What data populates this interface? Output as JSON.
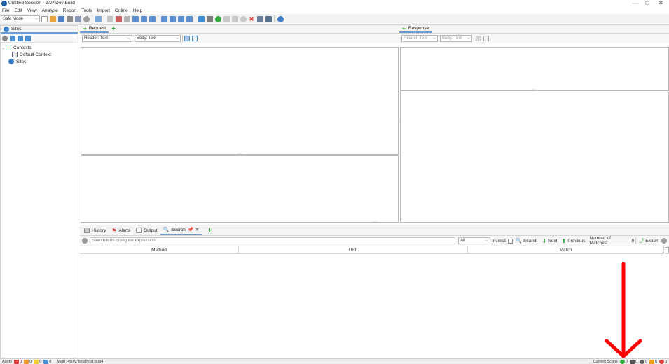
{
  "window": {
    "title": "Untitled Session - ZAP Dev Build",
    "minimize": "—",
    "maximize": "❐",
    "close": "✕"
  },
  "menu": [
    "File",
    "Edit",
    "View",
    "Analyse",
    "Report",
    "Tools",
    "Import",
    "Online",
    "Help"
  ],
  "toolbar": {
    "mode": "Safe Mode"
  },
  "sites_panel": {
    "tab_label": "Sites",
    "tree": {
      "contexts": "Contexts",
      "default_context": "Default Context",
      "sites": "Sites"
    }
  },
  "request_panel": {
    "tab_label": "Request",
    "header_combo": "Header: Text",
    "body_combo": "Body: Text"
  },
  "response_panel": {
    "tab_label": "Response",
    "header_combo": "Header: Text",
    "body_combo": "Body: Text"
  },
  "bottom_tabs": {
    "history": "History",
    "alerts": "Alerts",
    "output": "Output",
    "search": "Search"
  },
  "search_bar": {
    "placeholder": "Search term or regular expression",
    "scope": "All",
    "inverse": "Inverse",
    "search_btn": "Search",
    "next_btn": "Next",
    "previous_btn": "Previous",
    "matches_label": "Number of Matches:",
    "matches_value": "0",
    "export_btn": "Export"
  },
  "results_table": {
    "columns": [
      "Method",
      "URL",
      "Match"
    ]
  },
  "status_bar": {
    "alerts_label": "Alerts",
    "alert_counts": [
      "0",
      "0",
      "0",
      "0"
    ],
    "proxy": "Main Proxy: localhost:8094",
    "current_scans_label": "Current Scans",
    "scan_counts": [
      "0",
      "0",
      "0",
      "0",
      "0"
    ]
  },
  "colors": {
    "arrow": "#ff0000",
    "tab_underline": "#6a9ed3",
    "add_green": "#2eaa3a"
  }
}
